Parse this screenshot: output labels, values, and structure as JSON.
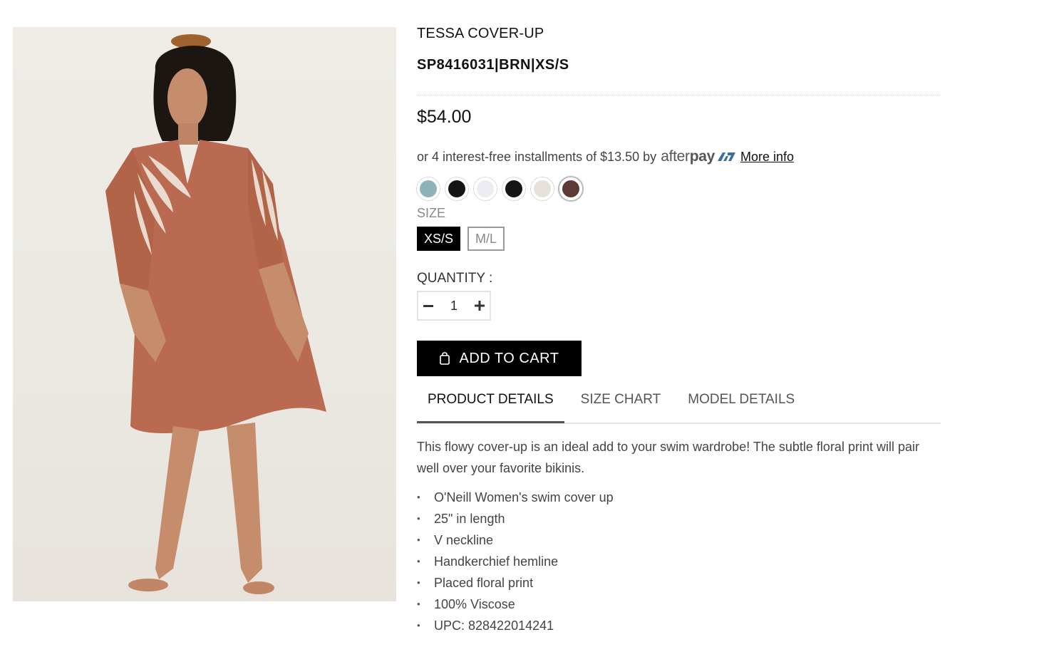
{
  "product": {
    "title": "TESSA COVER-UP",
    "sku": "SP8416031|BRN|XS/S",
    "price": "$54.00"
  },
  "afterpay": {
    "prefix": "or 4 interest-free installments of $13.50 by",
    "logo_light": "after",
    "logo_bold": "pay",
    "more_info": "More info"
  },
  "swatches": [
    {
      "name": "swatch-blue",
      "color": "#8fb1b8",
      "selected": false
    },
    {
      "name": "swatch-black",
      "color": "#141414",
      "selected": false
    },
    {
      "name": "swatch-white",
      "color": "#ecebf2",
      "selected": false
    },
    {
      "name": "swatch-black-2",
      "color": "#131613",
      "selected": false
    },
    {
      "name": "swatch-cream",
      "color": "#e6e1da",
      "selected": false
    },
    {
      "name": "swatch-brown",
      "color": "#5c3b36",
      "selected": true
    }
  ],
  "size": {
    "label": "SIZE",
    "options": [
      "XS/S",
      "M/L"
    ],
    "selected": "XS/S"
  },
  "quantity": {
    "label": "QUANTITY :",
    "value": "1",
    "minus_icon": "minus-icon",
    "plus_icon": "plus-icon"
  },
  "cart": {
    "label": "ADD TO CART",
    "icon": "shopping-bag-icon"
  },
  "tabs": [
    {
      "label": "PRODUCT DETAILS",
      "active": true
    },
    {
      "label": "SIZE CHART",
      "active": false
    },
    {
      "label": "MODEL DETAILS",
      "active": false
    }
  ],
  "details": {
    "description": "This flowy cover-up is an ideal add to your swim wardrobe! The subtle floral print will pair well over your favorite bikinis.",
    "features": [
      "O'Neill Women's swim cover up",
      "25\" in length",
      "V neckline",
      "Handkerchief hemline",
      "Placed floral print",
      "100% Viscose",
      "UPC: 828422014241"
    ]
  },
  "colors": {
    "dress": "#b96a51",
    "skin": "#c58d6c",
    "hair": "#1c1612",
    "background": "#ece9e3"
  }
}
